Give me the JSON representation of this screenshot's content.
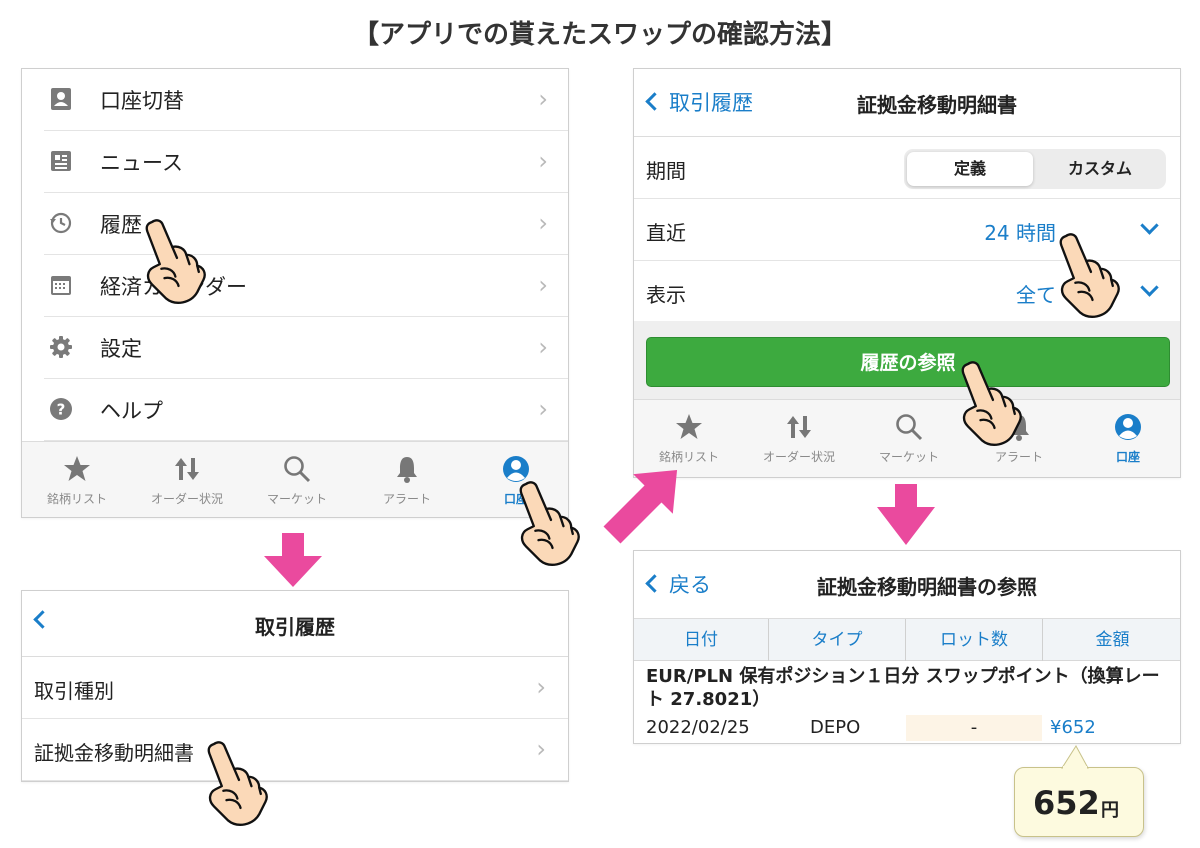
{
  "page_title": "【アプリでの貰えたスワップの確認方法】",
  "colors": {
    "accent": "#1a7ec9",
    "arrow": "#ea4a9e",
    "button": "#3daa3f"
  },
  "account_menu": {
    "items": [
      {
        "label": "口座切替",
        "icon": "account-card-icon"
      },
      {
        "label": "ニュース",
        "icon": "news-icon"
      },
      {
        "label": "履歴",
        "icon": "history-clock-icon"
      },
      {
        "label": "経済カレンダー",
        "icon": "calendar-icon"
      },
      {
        "label": "設定",
        "icon": "gear-icon"
      },
      {
        "label": "ヘルプ",
        "icon": "help-icon"
      }
    ]
  },
  "tabbar": {
    "tabs": [
      {
        "label": "銘柄リスト",
        "icon": "star-icon"
      },
      {
        "label": "オーダー状況",
        "icon": "updown-arrows-icon"
      },
      {
        "label": "マーケット",
        "icon": "magnifier-icon"
      },
      {
        "label": "アラート",
        "icon": "bell-icon"
      },
      {
        "label": "口座",
        "icon": "account-icon",
        "active": true
      }
    ]
  },
  "trade_history": {
    "title": "取引履歴",
    "items": [
      {
        "label": "取引種別"
      },
      {
        "label": "証拠金移動明細書"
      }
    ]
  },
  "statement": {
    "back_label": "取引履歴",
    "title": "証拠金移動明細書",
    "period_label": "期間",
    "segment": {
      "selected": "定義",
      "other": "カスタム"
    },
    "recent_label": "直近",
    "recent_value": "24 時間",
    "display_label": "表示",
    "display_value": "全て",
    "view_button": "履歴の参照"
  },
  "statement_view": {
    "back_label": "戻る",
    "title": "証拠金移動明細書の参照",
    "columns": [
      "日付",
      "タイプ",
      "ロット数",
      "金額"
    ],
    "record": {
      "description": "EUR/PLN 保有ポジション１日分 スワップポイント（換算レート 27.8021）",
      "date": "2022/02/25",
      "type": "DEPO",
      "lot": "-",
      "amount": "¥652"
    }
  },
  "callout": {
    "value": "652",
    "unit": "円"
  }
}
